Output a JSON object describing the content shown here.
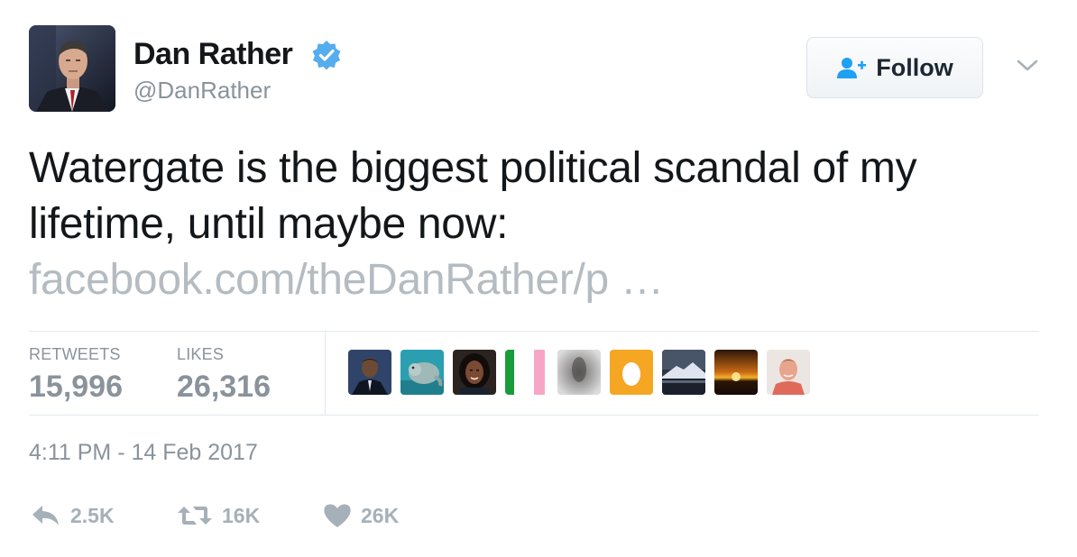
{
  "author": {
    "name": "Dan Rather",
    "handle": "@DanRather",
    "verified": true,
    "verified_color": "#55acee"
  },
  "follow_button": {
    "label": "Follow",
    "icon": "add-user-icon",
    "accent": "#1da1f2"
  },
  "more_menu": {
    "icon": "chevron-down-icon"
  },
  "tweet": {
    "text": "Watergate is the biggest political scandal of my lifetime, until maybe now:",
    "link": "facebook.com/theDanRather/p …",
    "link_color": "#b4bcc2"
  },
  "stats": {
    "retweets_label": "RETWEETS",
    "retweets_value": "15,996",
    "likes_label": "LIKES",
    "likes_value": "26,316"
  },
  "likers": [
    {
      "name": "suit-portrait-avatar",
      "colors": [
        "#1c2a44",
        "#3a4e70"
      ]
    },
    {
      "name": "manatee-avatar",
      "colors": [
        "#2a9aa8",
        "#6fc7c9"
      ]
    },
    {
      "name": "woman-portrait-avatar",
      "colors": [
        "#1a1a1a",
        "#6b3f2a"
      ]
    },
    {
      "name": "green-white-avatar",
      "colors": [
        "#1a9c3a",
        "#ffffff"
      ]
    },
    {
      "name": "pink-avatar",
      "colors": [
        "#f7a6c8",
        "#f7a6c8"
      ]
    },
    {
      "name": "blurred-figure-avatar",
      "colors": [
        "#8c8c8c",
        "#d5d5d5"
      ]
    },
    {
      "name": "default-egg-avatar",
      "colors": [
        "#f5a623",
        "#ffffff"
      ]
    },
    {
      "name": "mountain-lake-avatar",
      "colors": [
        "#2a3140",
        "#c9d1dc"
      ]
    },
    {
      "name": "sunset-avatar",
      "colors": [
        "#2b1608",
        "#f0a420"
      ]
    },
    {
      "name": "man-smiling-avatar",
      "colors": [
        "#e8dcd6",
        "#e09a86"
      ]
    }
  ],
  "timestamp": "4:11 PM - 14 Feb 2017",
  "actions": {
    "reply": {
      "icon": "reply-icon",
      "count": "2.5K"
    },
    "retweet": {
      "icon": "retweet-icon",
      "count": "16K"
    },
    "like": {
      "icon": "heart-icon",
      "count": "26K"
    }
  }
}
